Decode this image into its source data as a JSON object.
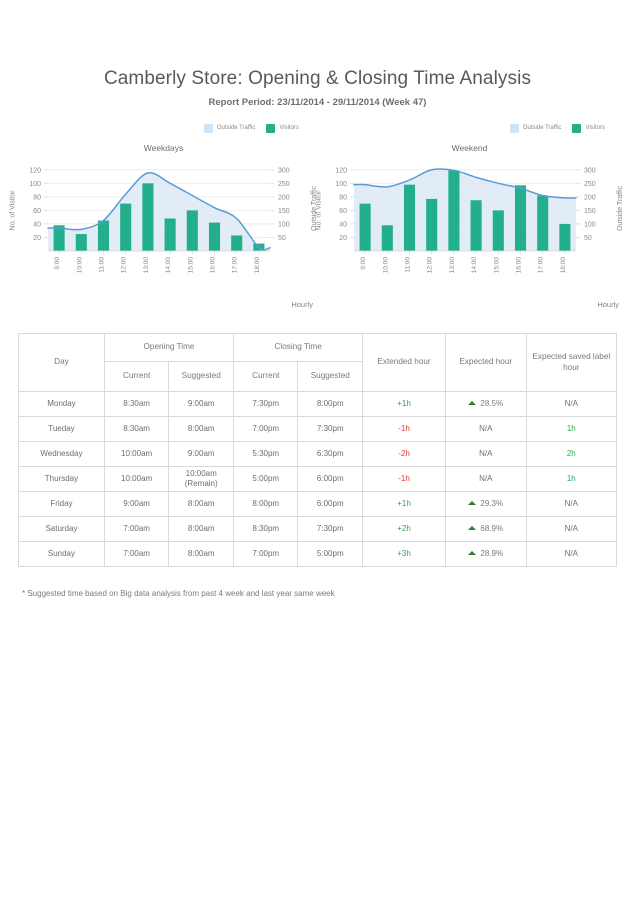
{
  "header": {
    "title": "Camberly Store: Opening & Closing Time Analysis",
    "subtitle": "Report Period: 23/11/2014 - 29/11/2014 (Week 47)"
  },
  "legend": {
    "outside_traffic": "Outside Traffic",
    "visitors": "Visitors",
    "outside_traffic_color": "#cfe4f5",
    "visitors_color": "#22b08c",
    "line_color": "#5b9bd5"
  },
  "chart_data": [
    {
      "type": "bar",
      "title": "Weekdays",
      "xlabel": "Hourly",
      "ylabel": "No. of Visitor",
      "y2label": "Outside Traffic",
      "categories": [
        "9:00",
        "10:00",
        "11:00",
        "12:00",
        "13:00",
        "14:00",
        "15:00",
        "16:00",
        "17:00",
        "18:00"
      ],
      "ylim": [
        0,
        130
      ],
      "y2lim": [
        0,
        325
      ],
      "yticks": [
        20,
        40,
        60,
        80,
        100,
        120
      ],
      "y2ticks": [
        50,
        100,
        150,
        200,
        250,
        300
      ],
      "grid": true,
      "legend_position": "top-right",
      "series": [
        {
          "name": "Visitors",
          "axis": "left",
          "kind": "bar",
          "values": [
            38,
            25,
            45,
            70,
            100,
            48,
            60,
            42,
            23,
            11
          ]
        },
        {
          "name": "Outside Traffic",
          "axis": "right",
          "kind": "area-line",
          "values": [
            85,
            80,
            113,
            210,
            288,
            250,
            205,
            160,
            120,
            12
          ]
        }
      ]
    },
    {
      "type": "bar",
      "title": "Weekend",
      "xlabel": "Hourly",
      "ylabel": "No. of Visitor",
      "y2label": "Outside Traffic",
      "categories": [
        "9:00",
        "10:00",
        "11:00",
        "12:00",
        "13:00",
        "14:00",
        "15:00",
        "16:00",
        "17:00",
        "18:00"
      ],
      "ylim": [
        0,
        130
      ],
      "y2lim": [
        0,
        325
      ],
      "yticks": [
        20,
        40,
        60,
        80,
        100,
        120
      ],
      "y2ticks": [
        50,
        100,
        150,
        200,
        250,
        300
      ],
      "grid": true,
      "legend_position": "top-right",
      "series": [
        {
          "name": "Visitors",
          "axis": "left",
          "kind": "bar",
          "values": [
            70,
            38,
            98,
            77,
            119,
            75,
            60,
            97,
            82,
            40
          ]
        },
        {
          "name": "Outside Traffic",
          "axis": "right",
          "kind": "area-line",
          "values": [
            245,
            237,
            262,
            300,
            298,
            272,
            250,
            232,
            205,
            196
          ]
        }
      ]
    }
  ],
  "table": {
    "headers": {
      "day": "Day",
      "opening_time": "Opening Time",
      "closing_time": "Closing Time",
      "current": "Current",
      "suggested": "Suggested",
      "extended_hour": "Extended hour",
      "expected_hour": "Expected hour",
      "expected_saved_label_hour": "Expected saved label hour"
    },
    "rows": [
      {
        "day": "Monday",
        "open_current": "8:30am",
        "open_suggested": "9:00am",
        "close_current": "7:30pm",
        "close_suggested": "8:00pm",
        "extended": "+1h",
        "extended_sign": "pos",
        "expected": "28.5%",
        "expected_trend": "up",
        "saved": "N/A",
        "saved_style": "plain"
      },
      {
        "day": "Tueday",
        "open_current": "8:30am",
        "open_suggested": "8:00am",
        "close_current": "7:00pm",
        "close_suggested": "7:30pm",
        "extended": "-1h",
        "extended_sign": "neg",
        "expected": "N/A",
        "expected_trend": "none",
        "saved": "1h",
        "saved_style": "green"
      },
      {
        "day": "Wednesday",
        "open_current": "10:00am",
        "open_suggested": "9:00am",
        "close_current": "5:30pm",
        "close_suggested": "6:30pm",
        "extended": "-2h",
        "extended_sign": "neg",
        "expected": "N/A",
        "expected_trend": "none",
        "saved": "2h",
        "saved_style": "green"
      },
      {
        "day": "Thursday",
        "open_current": "10:00am",
        "open_suggested": "10:00am",
        "open_suggested_note": "(Remain)",
        "close_current": "5:00pm",
        "close_suggested": "6:00pm",
        "extended": "-1h",
        "extended_sign": "neg",
        "expected": "N/A",
        "expected_trend": "none",
        "saved": "1h",
        "saved_style": "green"
      },
      {
        "day": "Friday",
        "open_current": "9:00am",
        "open_suggested": "8:00am",
        "close_current": "8:00pm",
        "close_suggested": "6:00pm",
        "extended": "+1h",
        "extended_sign": "pos",
        "expected": "29.3%",
        "expected_trend": "up",
        "saved": "N/A",
        "saved_style": "plain"
      },
      {
        "day": "Saturday",
        "open_current": "7:00am",
        "open_suggested": "8:00am",
        "close_current": "8:30pm",
        "close_suggested": "7:30pm",
        "extended": "+2h",
        "extended_sign": "pos",
        "expected": "68.9%",
        "expected_trend": "up",
        "saved": "N/A",
        "saved_style": "plain"
      },
      {
        "day": "Sunday",
        "open_current": "7:00am",
        "open_suggested": "8:00am",
        "close_current": "7:00pm",
        "close_suggested": "5:00pm",
        "extended": "+3h",
        "extended_sign": "pos",
        "expected": "28.9%",
        "expected_trend": "up",
        "saved": "N/A",
        "saved_style": "plain"
      }
    ]
  },
  "footnote": "* Suggested time based on Big data analysis from past 4 week and last year same week"
}
